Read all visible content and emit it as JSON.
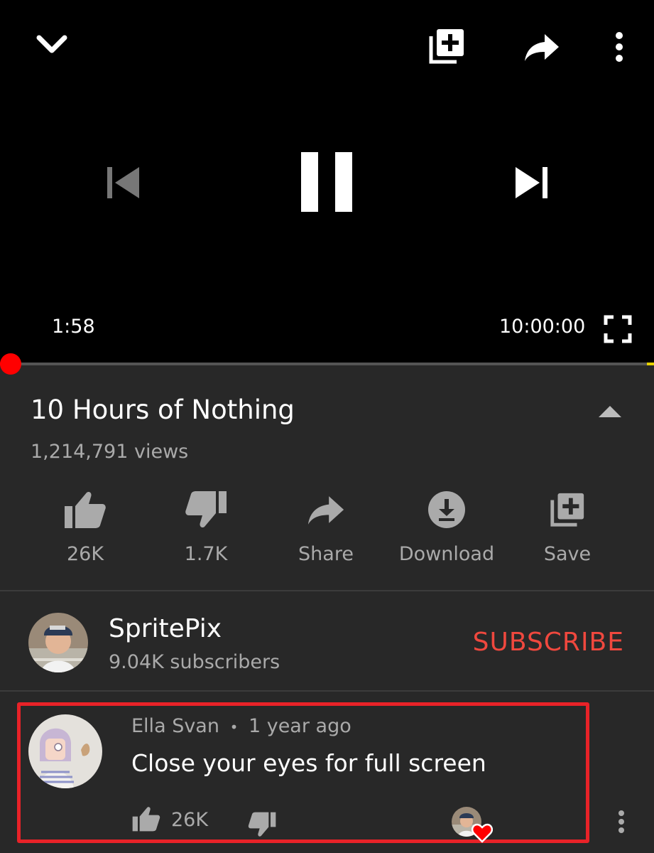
{
  "player": {
    "current_time": "1:58",
    "duration": "10:00:00",
    "progress": 0.0033
  },
  "video": {
    "title": "10 Hours of Nothing",
    "views": "1,214,791 views"
  },
  "actions": {
    "like_count": "26K",
    "dislike_count": "1.7K",
    "share_label": "Share",
    "download_label": "Download",
    "save_label": "Save"
  },
  "channel": {
    "name": "SpritePix",
    "subscribers": "9.04K subscribers",
    "subscribe_label": "SUBSCRIBE"
  },
  "comment": {
    "author": "Ella Svan",
    "separator": "•",
    "time_ago": "1 year ago",
    "text": "Close your eyes for full screen",
    "likes": "26K"
  },
  "colors": {
    "accent_red": "#ff0000",
    "subscribe_red": "#f0483e",
    "highlight_border": "#e82228",
    "background": "#282828"
  }
}
